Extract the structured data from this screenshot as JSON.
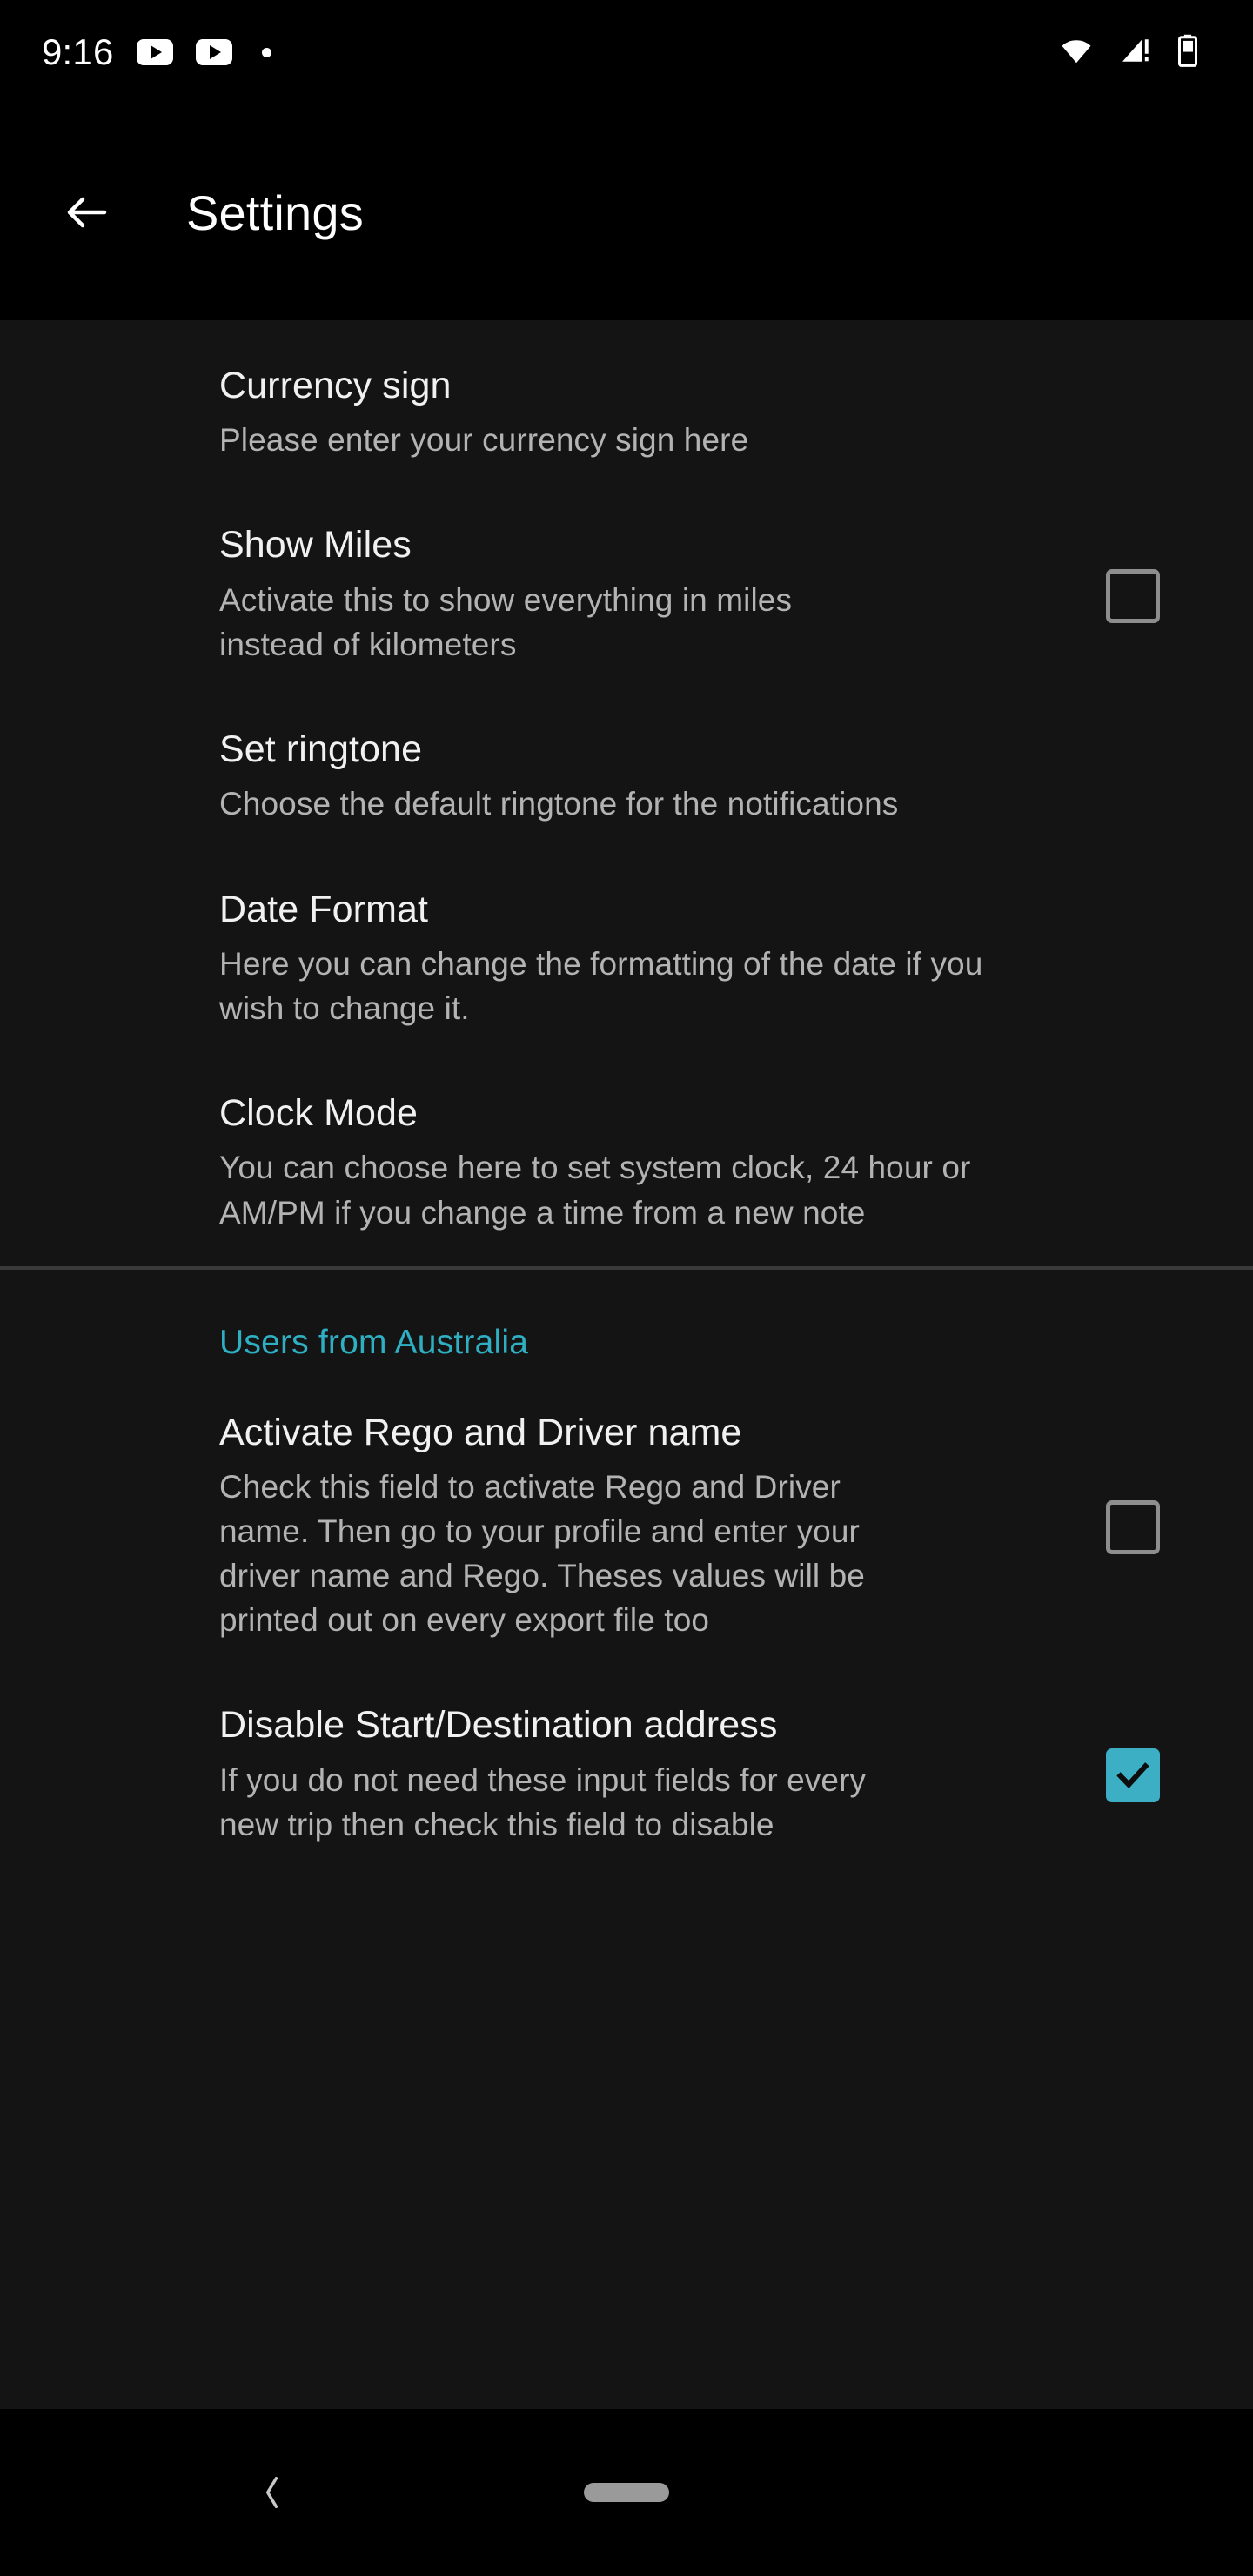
{
  "statusbar": {
    "time": "9:16",
    "icons": [
      "youtube-icon",
      "youtube-icon",
      "dot-indicator"
    ],
    "right_icons": [
      "wifi-icon",
      "cellular-signal-alert-icon",
      "battery-icon"
    ]
  },
  "appbar": {
    "back_label": "back-arrow",
    "title": "Settings"
  },
  "settings": {
    "general_items": [
      {
        "title": "Currency sign",
        "summary": "Please enter your currency sign here",
        "has_checkbox": false,
        "checked": false
      },
      {
        "title": "Show Miles",
        "summary": "Activate this to show everything in miles instead of kilometers",
        "has_checkbox": true,
        "checked": false
      },
      {
        "title": "Set ringtone",
        "summary": "Choose the default ringtone for the notifications",
        "has_checkbox": false,
        "checked": false
      },
      {
        "title": "Date Format",
        "summary": "Here you can change the formatting of the date if you wish to change it.",
        "has_checkbox": false,
        "checked": false
      },
      {
        "title": "Clock Mode",
        "summary": "You can choose here to set system clock, 24 hour or AM/PM if you change a time from a new note",
        "has_checkbox": false,
        "checked": false
      }
    ],
    "australia_header": "Users from Australia",
    "australia_items": [
      {
        "title": "Activate Rego and Driver name",
        "summary": "Check this field to activate Rego and Driver name. Then go to your profile and enter your driver name and Rego.  Theses values will be printed out on every export file too",
        "has_checkbox": true,
        "checked": false
      },
      {
        "title": "Disable Start/Destination address",
        "summary": "If you do not need these input fields for every new trip then check this field to disable",
        "has_checkbox": true,
        "checked": true
      }
    ]
  },
  "navbar": {
    "back_label": "nav-back-chevron",
    "home_label": "nav-home-pill"
  },
  "colors": {
    "accent": "#2FAFC2",
    "checkbox_on": "#3CAFC4",
    "background": "#141414",
    "appbar_background": "#000000",
    "title_text": "#f1f1f1",
    "summary_text": "#b3b3b3"
  }
}
